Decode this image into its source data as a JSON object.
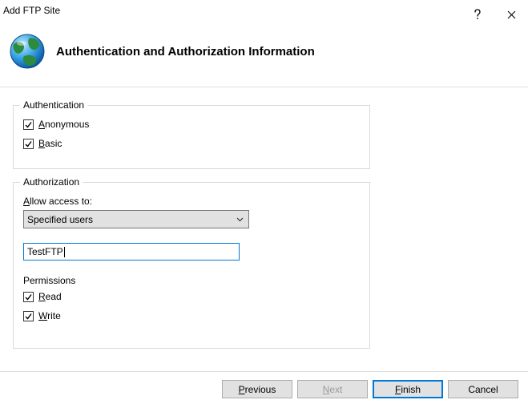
{
  "window": {
    "title": "Add FTP Site"
  },
  "header": {
    "title": "Authentication and Authorization Information"
  },
  "auth_group": {
    "label": "Authentication",
    "anonymous": {
      "prefix": "A",
      "rest": "nonymous",
      "checked": true
    },
    "basic": {
      "prefix": "B",
      "rest": "asic",
      "checked": true
    }
  },
  "authz_group": {
    "label": "Authorization",
    "allow_label": {
      "prefix": "A",
      "rest": "llow access to:"
    },
    "allow_select": "Specified users",
    "user_value": "TestFTP",
    "perm_label": "Permissions",
    "read": {
      "prefix": "R",
      "rest": "ead",
      "checked": true
    },
    "write": {
      "prefix": "W",
      "rest": "rite",
      "checked": true
    }
  },
  "footer": {
    "previous": {
      "prefix": "P",
      "rest": "revious"
    },
    "next": {
      "prefix": "N",
      "rest": "ext"
    },
    "finish": {
      "prefix": "F",
      "rest": "inish"
    },
    "cancel": "Cancel"
  }
}
